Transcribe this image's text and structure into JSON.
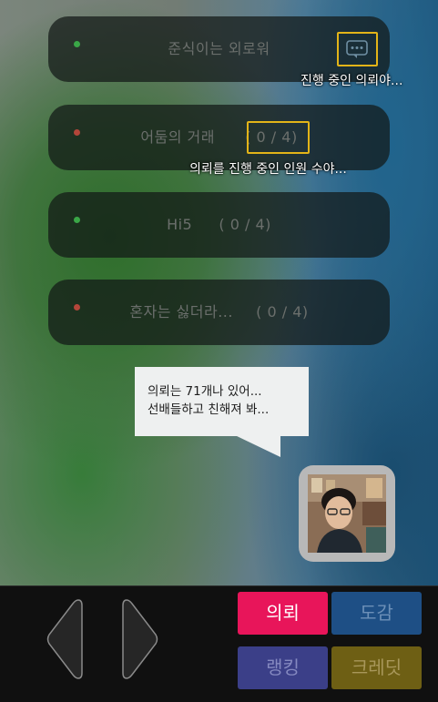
{
  "colors": {
    "dot_green": "#3aa647",
    "dot_red": "#b3463a",
    "highlight": "#e3b418",
    "btn_request": "#e8155a",
    "btn_collection": "#1e4f85",
    "btn_ranking": "#3b3f88",
    "btn_credit": "#6e5f14"
  },
  "quests": [
    {
      "title": "준식이는 외로워",
      "progress": "",
      "status": "green",
      "icon": "chat-icon",
      "note": "진행 중인 의뢰야..."
    },
    {
      "title": "어둠의 거래",
      "progress": "( 0 / 4)",
      "status": "red",
      "note": "의뢰를 진행 중인 인원 수야..."
    },
    {
      "title": "Hi5",
      "progress": "( 0 / 4)",
      "status": "green"
    },
    {
      "title": "혼자는 싫더라...",
      "progress": "( 0 / 4)",
      "status": "red"
    }
  ],
  "speech": {
    "line1": "의뢰는 71개나 있어...",
    "line2": "선배들하고 친해져 봐..."
  },
  "nav": {
    "prev_icon": "chevron-left-icon",
    "next_icon": "chevron-right-icon"
  },
  "menu": {
    "request": "의뢰",
    "collection": "도감",
    "ranking": "랭킹",
    "credit": "크레딧"
  }
}
